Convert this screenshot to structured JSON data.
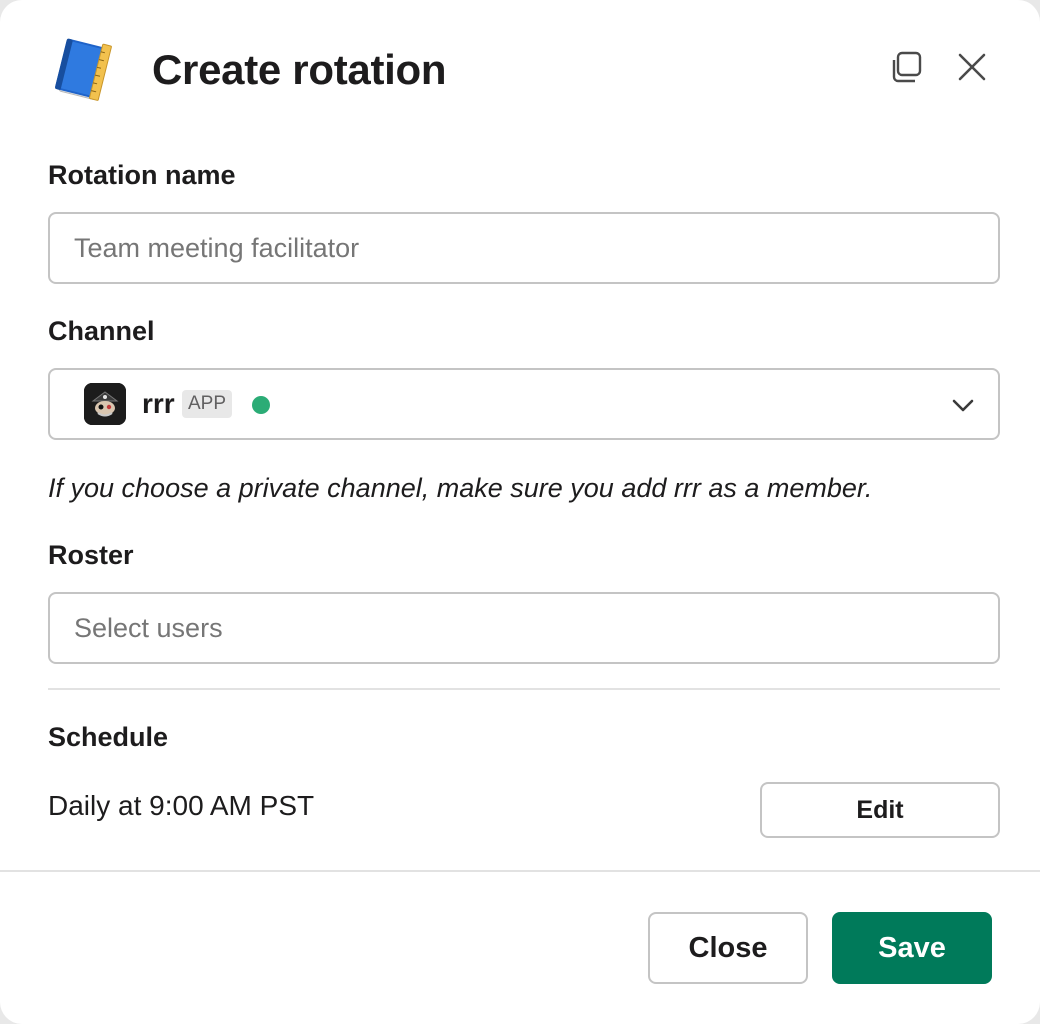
{
  "modal": {
    "title": "Create rotation",
    "app_icon": "notebook-icon",
    "popout_icon": "popout-icon",
    "close_icon": "close-icon"
  },
  "rotation_name": {
    "label": "Rotation name",
    "value": "",
    "placeholder": "Team meeting facilitator"
  },
  "channel": {
    "label": "Channel",
    "selected_name": "rrr",
    "badge": "APP",
    "status_color": "#2bac76",
    "helper_text": "If you choose a private channel, make sure you add rrr as a member."
  },
  "roster": {
    "label": "Roster",
    "value": "",
    "placeholder": "Select users"
  },
  "schedule": {
    "label": "Schedule",
    "summary": "Daily at 9:00 AM PST",
    "edit_label": "Edit"
  },
  "footer": {
    "close_label": "Close",
    "save_label": "Save",
    "primary_color": "#007a5a"
  }
}
